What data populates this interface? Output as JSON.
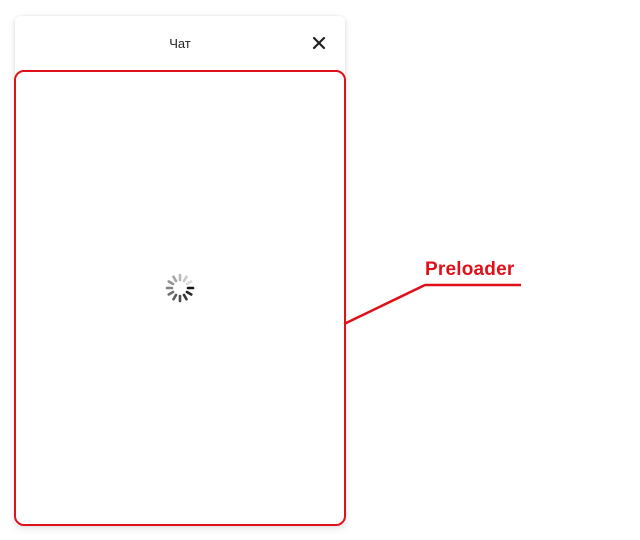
{
  "chat": {
    "title": "Чат",
    "close_icon": "close-icon",
    "loading_icon": "spinner-icon"
  },
  "annotation": {
    "label": "Preloader",
    "color": "#e0101a"
  }
}
